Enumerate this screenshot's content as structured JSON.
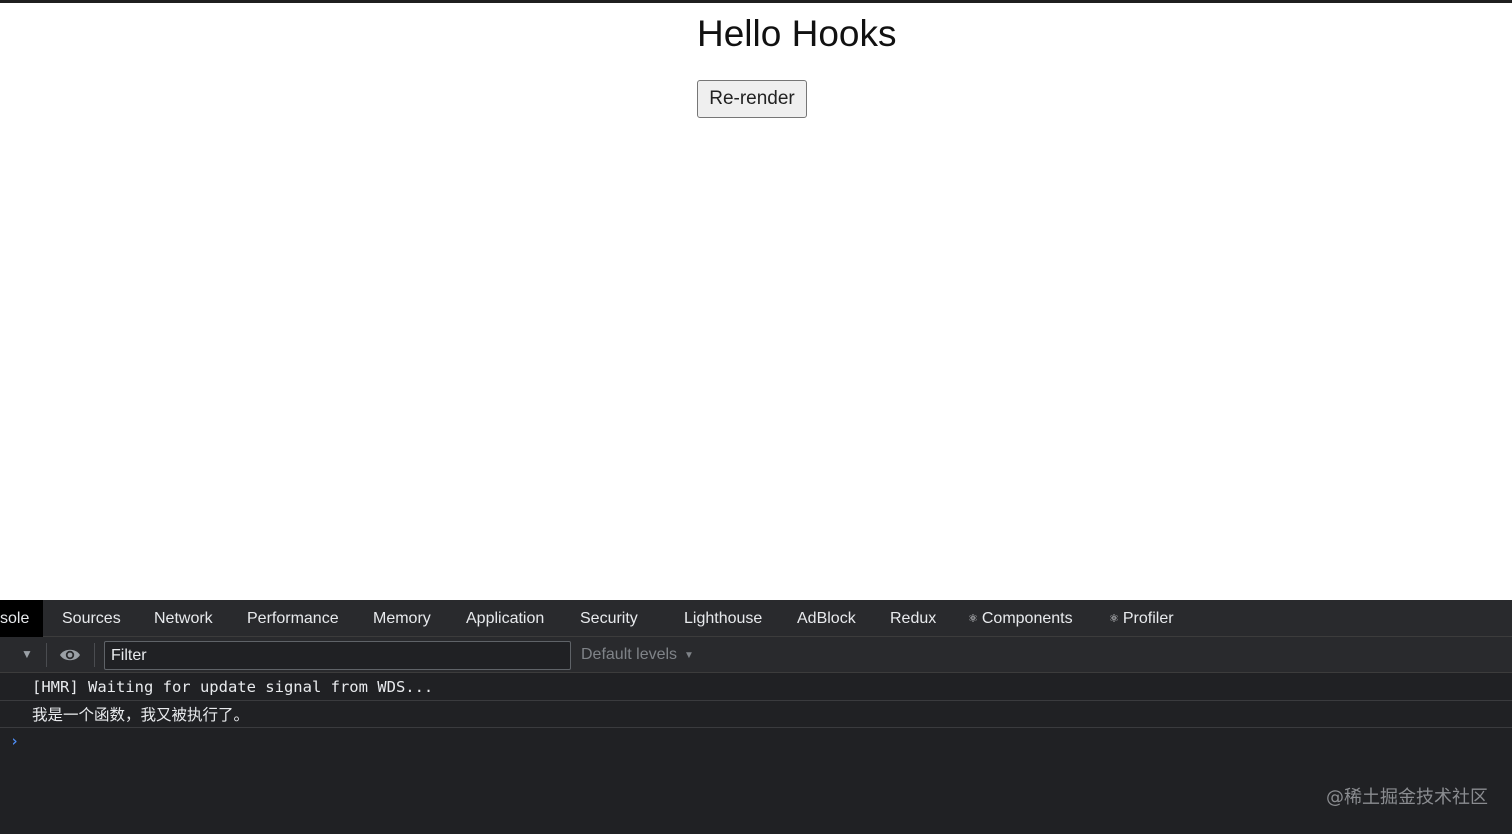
{
  "page": {
    "title": "Hello Hooks",
    "button_label": "Re-render"
  },
  "devtools": {
    "tabs": [
      {
        "label": "sole",
        "active": true
      },
      {
        "label": "Sources"
      },
      {
        "label": "Network"
      },
      {
        "label": "Performance"
      },
      {
        "label": "Memory"
      },
      {
        "label": "Application"
      },
      {
        "label": "Security"
      },
      {
        "label": "Lighthouse"
      },
      {
        "label": "AdBlock"
      },
      {
        "label": "Redux"
      },
      {
        "label": "Components",
        "icon": "react-icon"
      },
      {
        "label": "Profiler",
        "icon": "react-icon"
      }
    ],
    "toolbar": {
      "filter_placeholder": "Filter",
      "levels_label": "Default levels"
    },
    "console_lines": [
      "[HMR] Waiting for update signal from WDS...",
      "我是一个函数，我又被执行了。"
    ],
    "watermark": "@稀土掘金技术社区"
  },
  "colors": {
    "devtools_bg": "#202124",
    "tabbar_bg": "#292a2d",
    "prompt_accent": "#4e8df5"
  }
}
